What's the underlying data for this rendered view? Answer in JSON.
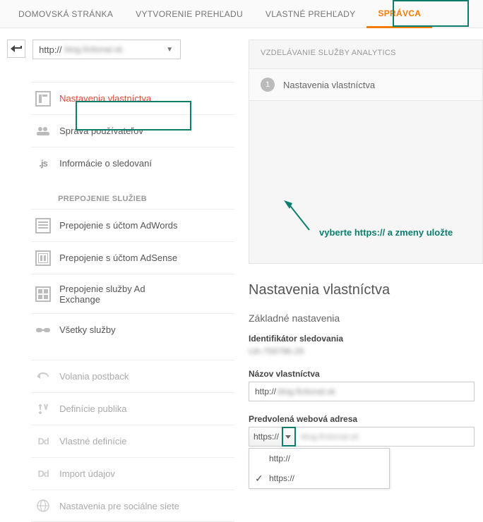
{
  "topnav": {
    "items": [
      "DOMOVSKÁ STRÁNKA",
      "VYTVORENIE PREHĽADU",
      "VLASTNÉ PREHĽADY",
      "SPRÁVCA"
    ]
  },
  "property_selector": {
    "protocol": "http://",
    "domain": "blog.fictional.sk"
  },
  "sidebar": {
    "items": [
      {
        "label": "Nastavenia vlastníctva"
      },
      {
        "label": "Správa používateľov"
      },
      {
        "label": "Informácie o sledovaní"
      }
    ],
    "services_title": "PREPOJENIE SLUŽIEB",
    "services": [
      {
        "label": "Prepojenie s účtom AdWords"
      },
      {
        "label": "Prepojenie s účtom AdSense"
      },
      {
        "label": "Prepojenie služby Ad Exchange"
      },
      {
        "label": "Všetky služby"
      }
    ],
    "extras": [
      {
        "label": "Volania postback"
      },
      {
        "label": "Definície publika"
      },
      {
        "label": "Vlastné definície"
      },
      {
        "label": "Import údajov"
      },
      {
        "label": "Nastavenia pre sociálne siete"
      }
    ]
  },
  "training": {
    "header": "VZDELÁVANIE SLUŽBY ANALYTICS",
    "step_number": "1",
    "step_label": "Nastavenia vlastníctva"
  },
  "settings": {
    "title": "Nastavenia vlastníctva",
    "subtitle": "Základné nastavenia",
    "tracking_id_label": "Identifikátor sledovania",
    "tracking_id_value": "UA-759796-29",
    "name_label": "Názov vlastníctva",
    "name_protocol": "http://",
    "name_domain": "blog.fictional.sk",
    "url_label": "Predvolená webová adresa",
    "url_protocol": "https://",
    "url_domain": "blog.fictional.sk",
    "dropdown_options": [
      "http://",
      "https://"
    ]
  },
  "annotation": "vyberte https:// a zmeny uložte"
}
